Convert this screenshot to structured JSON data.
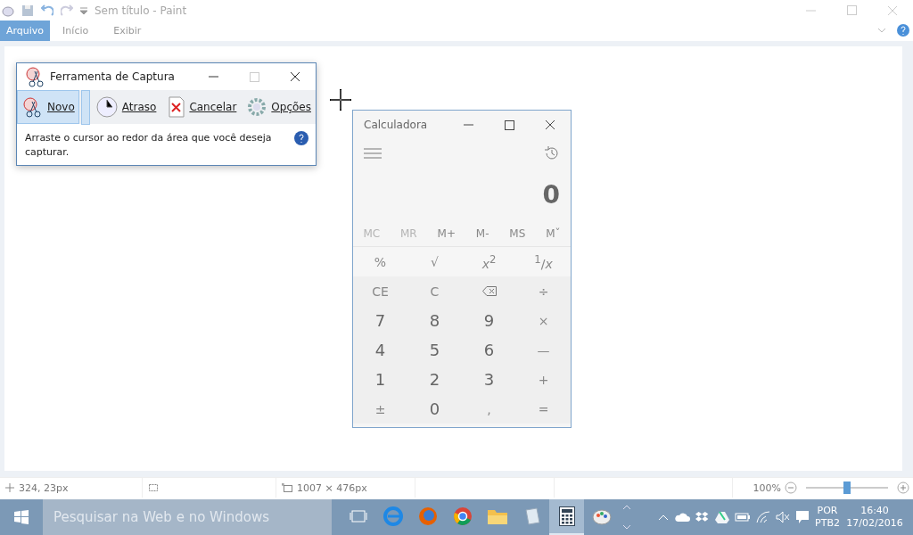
{
  "paint": {
    "title": "Sem título - Paint",
    "tabs": [
      {
        "label": "Arquivo",
        "selected": true
      },
      {
        "label": "Início",
        "selected": false
      },
      {
        "label": "Exibir",
        "selected": false
      }
    ],
    "status": {
      "position": "324, 23px",
      "canvas_size": "1007 × 476px",
      "zoom": "100%",
      "zoom_slider": {
        "level": 0.5
      }
    }
  },
  "snipping_tool": {
    "title": "Ferramenta de Captura",
    "buttons": [
      {
        "label": "Novo",
        "kind": "new",
        "selected": true
      },
      {
        "label": "Atraso",
        "kind": "delay",
        "selected": false
      },
      {
        "label": "Cancelar",
        "kind": "cancel",
        "selected": false
      },
      {
        "label": "Opções",
        "kind": "options",
        "selected": false
      }
    ],
    "message": "Arraste o cursor ao redor da área que você deseja capturar."
  },
  "calculator": {
    "title": "Calculadora",
    "display": "0",
    "memory": [
      {
        "label": "MC",
        "disabled": true
      },
      {
        "label": "MR",
        "disabled": true
      },
      {
        "label": "M+",
        "disabled": false
      },
      {
        "label": "M-",
        "disabled": false
      },
      {
        "label": "MS",
        "disabled": false
      },
      {
        "label": "Mˇ",
        "disabled": false
      }
    ],
    "keys": [
      {
        "label": "%",
        "kind": "function"
      },
      {
        "label": "√",
        "kind": "function"
      },
      {
        "label": "*x*$^{2}$",
        "kind": "function"
      },
      {
        "label": "$^{1}$/*x*",
        "kind": "function"
      },
      {
        "label": "CE",
        "kind": "operator"
      },
      {
        "label": "C",
        "kind": "operator"
      },
      {
        "kind": "backspace"
      },
      {
        "label": "÷",
        "kind": "operator"
      },
      {
        "label": "7",
        "kind": "digit"
      },
      {
        "label": "8",
        "kind": "digit"
      },
      {
        "label": "9",
        "kind": "digit"
      },
      {
        "label": "×",
        "kind": "operator"
      },
      {
        "label": "4",
        "kind": "digit"
      },
      {
        "label": "5",
        "kind": "digit"
      },
      {
        "label": "6",
        "kind": "digit"
      },
      {
        "label": "—",
        "kind": "operator"
      },
      {
        "label": "1",
        "kind": "digit"
      },
      {
        "label": "2",
        "kind": "digit"
      },
      {
        "label": "3",
        "kind": "digit"
      },
      {
        "label": "+",
        "kind": "operator"
      },
      {
        "label": "±",
        "kind": "operator"
      },
      {
        "label": "0",
        "kind": "digit"
      },
      {
        "label": ",",
        "kind": "operator"
      },
      {
        "label": "=",
        "kind": "operator"
      }
    ]
  },
  "taskbar": {
    "search": {
      "placeholder": "Pesquisar na Web e no Windows"
    },
    "apps": [
      {
        "kind": "task-view",
        "active": false
      },
      {
        "kind": "edge",
        "active": false
      },
      {
        "kind": "firefox",
        "active": false
      },
      {
        "kind": "chrome",
        "active": false
      },
      {
        "kind": "folder",
        "active": false
      },
      {
        "kind": "notepad",
        "active": false
      },
      {
        "kind": "calculator",
        "active": true
      },
      {
        "kind": "paint",
        "active": false
      }
    ],
    "language": "POR",
    "layout": "PTB2",
    "time": "16:40",
    "date": "17/02/2016"
  }
}
